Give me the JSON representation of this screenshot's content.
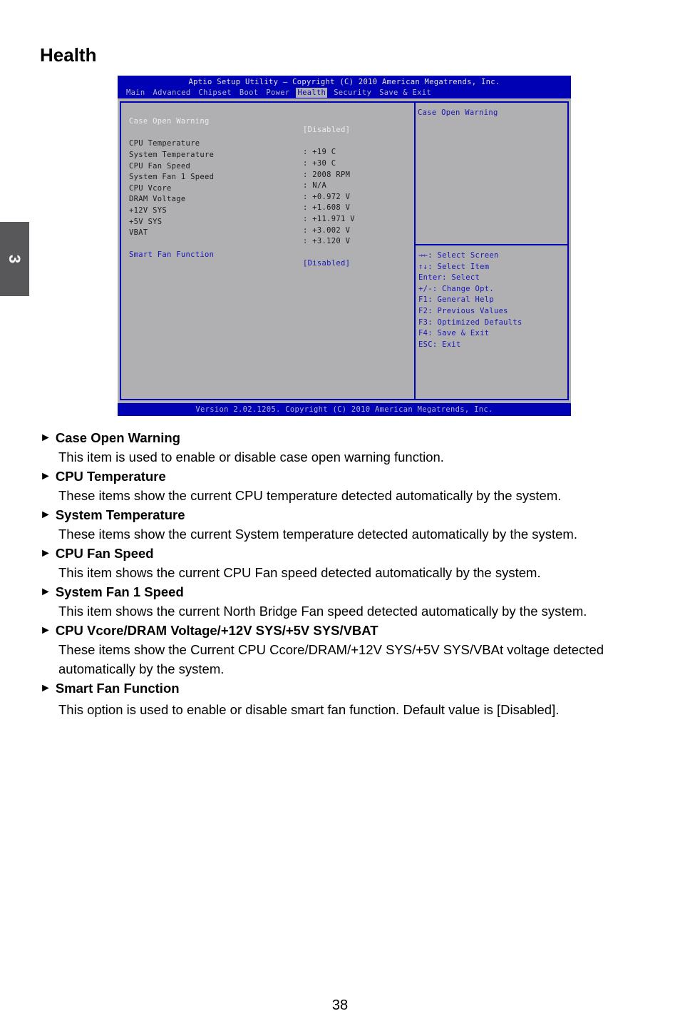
{
  "page": {
    "title": "Health",
    "chapter": "3",
    "page_number": "38"
  },
  "bios": {
    "title": "Aptio Setup Utility – Copyright (C) 2010 American Megatrends, Inc.",
    "tabs": [
      {
        "label": "Main",
        "active": false
      },
      {
        "label": "Advanced",
        "active": false
      },
      {
        "label": "Chipset",
        "active": false
      },
      {
        "label": "Boot",
        "active": false
      },
      {
        "label": "Power",
        "active": false
      },
      {
        "label": "Health",
        "active": true
      },
      {
        "label": "Security",
        "active": false
      },
      {
        "label": "Save & Exit",
        "active": false
      }
    ],
    "rows": [
      {
        "label": "Case Open Warning",
        "value": "[Disabled]"
      },
      {
        "label": "CPU Temperature",
        "value": ": +19 C"
      },
      {
        "label": "System Temperature",
        "value": ": +30 C"
      },
      {
        "label": "CPU Fan Speed",
        "value": ": 2008 RPM"
      },
      {
        "label": "System Fan 1 Speed",
        "value": ": N/A"
      },
      {
        "label": "CPU Vcore",
        "value": ": +0.972 V"
      },
      {
        "label": "DRAM Voltage",
        "value": ": +1.608 V"
      },
      {
        "label": "+12V SYS",
        "value": ": +11.971 V"
      },
      {
        "label": "+5V SYS",
        "value": ": +3.002 V"
      },
      {
        "label": "VBAT",
        "value": ": +3.120 V"
      },
      {
        "label": "Smart Fan Function",
        "value": "[Disabled]"
      }
    ],
    "help_title": "Case Open Warning",
    "keys": [
      "→←: Select Screen",
      "↑↓: Select Item",
      "Enter: Select",
      "+/-: Change Opt.",
      "F1: General Help",
      "F2: Previous Values",
      "F3: Optimized Defaults",
      "F4: Save & Exit",
      "ESC: Exit"
    ],
    "footer": "Version 2.02.1205. Copyright (C) 2010 American Megatrends, Inc.",
    "colors": {
      "header_blue": "#0000b4",
      "panel_grey": "#b0b0b2",
      "link_blue": "#1616b8"
    }
  },
  "descriptions": [
    {
      "heading": "Case Open Warning",
      "text": "This item is used to enable or disable case open warning function."
    },
    {
      "heading": "CPU Temperature",
      "text": "These items show the current CPU temperature detected automatically by the system."
    },
    {
      "heading": "System Temperature",
      "text": "These items show the current System temperature detected automatically by the system."
    },
    {
      "heading": "CPU Fan Speed",
      "text": "This item shows the current CPU Fan speed detected automatically by the system."
    },
    {
      "heading": "System Fan 1 Speed",
      "text": "This item shows the current North Bridge Fan speed detected automatically by the system."
    },
    {
      "heading": "CPU Vcore/DRAM Voltage/+12V SYS/+5V SYS/VBAT",
      "text": "These items show the Current CPU Ccore/DRAM/+12V SYS/+5V SYS/VBAt voltage detected automatically by the system."
    },
    {
      "heading": "Smart Fan Function",
      "text": "This option is used to enable or disable smart fan function. Default value is [Disabled]."
    }
  ],
  "arrow_glyph": "►"
}
